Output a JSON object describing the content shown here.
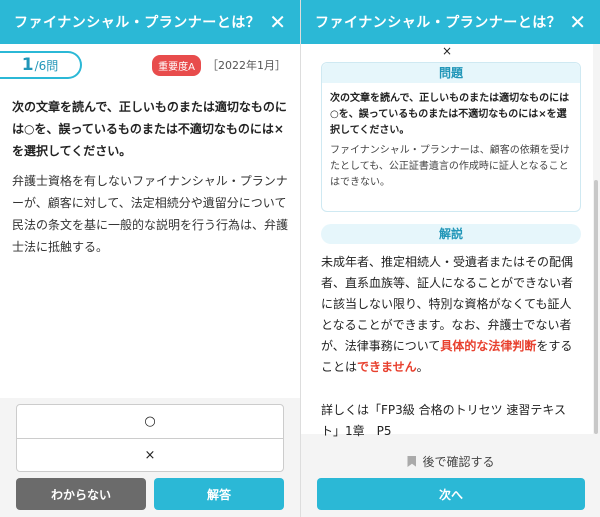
{
  "left": {
    "title": "ファイナンシャル・プランナーとは？",
    "close": "✕",
    "counter_current": "1",
    "counter_total": "/6問",
    "badge": "重要度A",
    "year": "［2022年1月］",
    "instruction": "次の文章を読んで、正しいものまたは適切なものには○を、誤っているものまたは不適切なものには×を選択してください。",
    "question": "弁護士資格を有しないファイナンシャル・プランナーが、顧客に対して、法定相続分や遺留分について民法の条文を基に一般的な説明を行う行為は、弁護士法に抵触する。",
    "choices": [
      "○",
      "×"
    ],
    "btn_unknown": "わからない",
    "btn_answer": "解答"
  },
  "right": {
    "title": "ファイナンシャル・プランナーとは？",
    "close": "✕",
    "answer_mark": "×",
    "q_header": "問題",
    "q_instruction": "次の文章を読んで、正しいものまたは適切なものには○を、誤っているものまたは不適切なものには×を選択してください。",
    "q_text": "ファイナンシャル・プランナーは、顧客の依頼を受けたとしても、公正証書遺言の作成時に証人となることはできない。",
    "exp_header": "解説",
    "exp_part1": "未成年者、推定相続人・受遺者またはその配偶者、直系血族等、証人になることができない者に該当しない限り、特別な資格がなくても証人となることができます。なお、弁護士でない者が、法律事務について",
    "exp_red1": "具体的な法律判断",
    "exp_part2": "をすることは",
    "exp_red2": "できません",
    "exp_end": "。",
    "reference": "詳しくは「FP3級 合格のトリセツ 速習テキスト」1章　P5",
    "later": "後で確認する",
    "next": "次へ"
  },
  "colors": {
    "accent": "#2bb8d6",
    "badge": "#e84c4c",
    "highlight": "#e8402e"
  }
}
